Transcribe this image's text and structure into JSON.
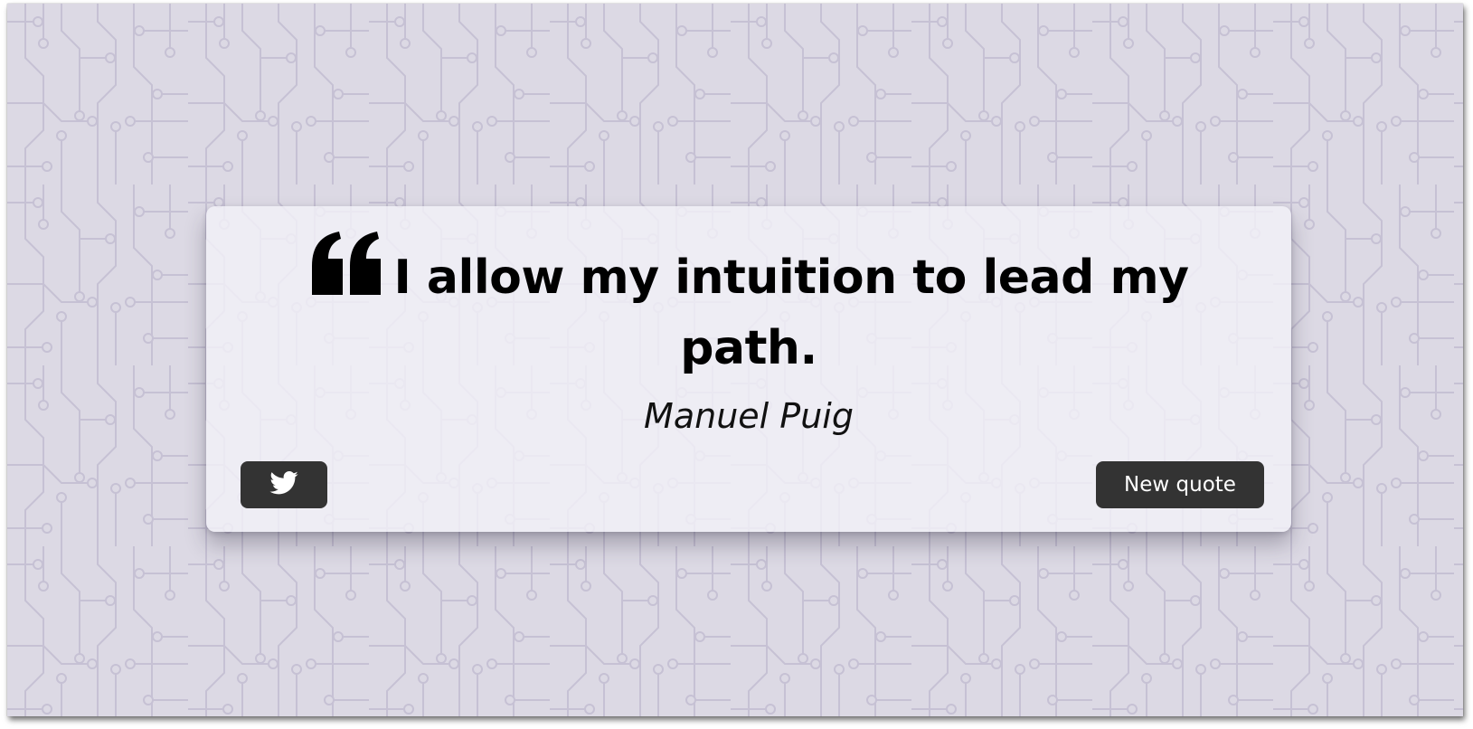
{
  "quote": {
    "text": "I allow my intuition to lead my path.",
    "author": "Manuel Puig"
  },
  "actions": {
    "tweet_icon": "twitter-icon",
    "new_quote_label": "New quote"
  },
  "colors": {
    "background": "#dcd9e4",
    "pattern_line": "#c9c4d6",
    "card": "#f3f1f7",
    "button": "#333333",
    "button_text": "#ffffff",
    "text": "#000000"
  }
}
